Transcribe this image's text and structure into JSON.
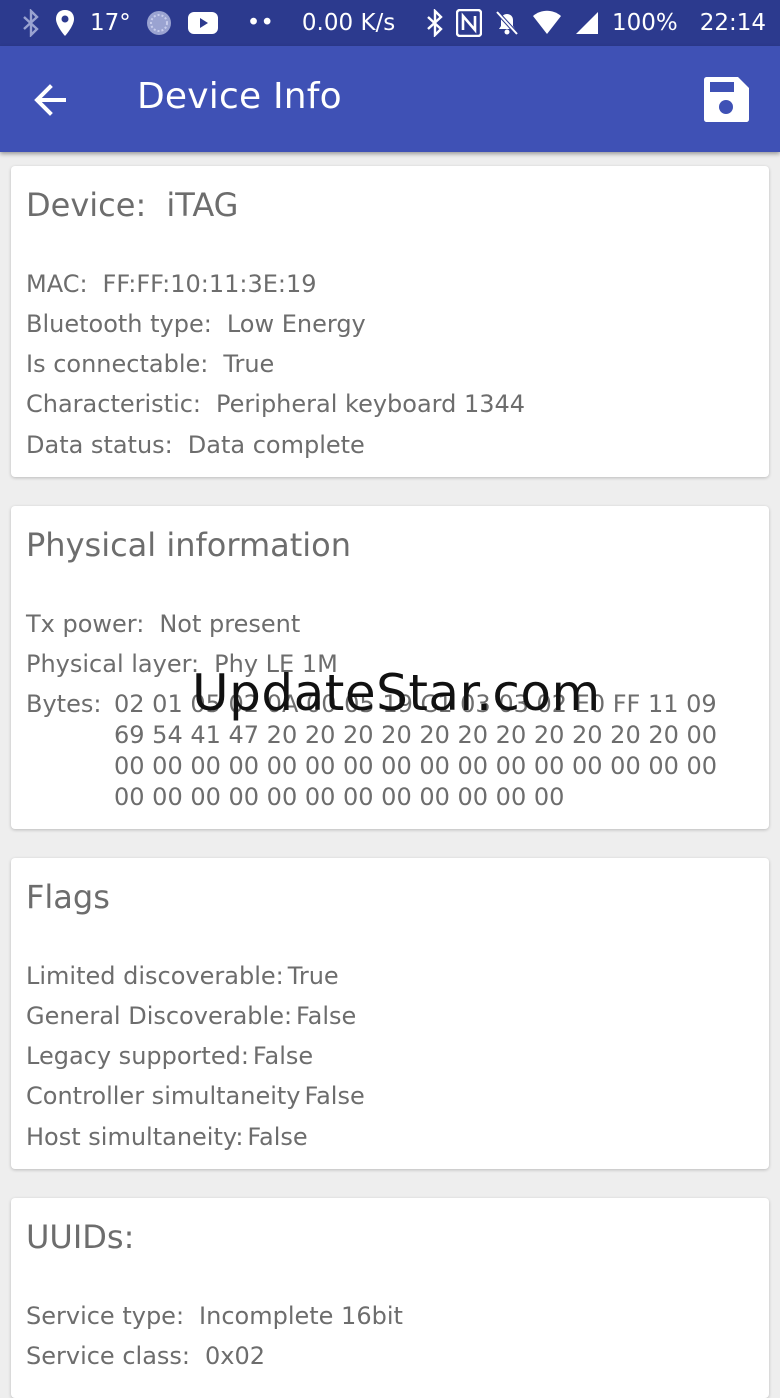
{
  "status_bar": {
    "temperature": "17°",
    "dots": "••",
    "speed": "0.00 K/s",
    "battery": "100%",
    "time": "22:14"
  },
  "app_bar": {
    "title": "Device Info",
    "back_icon": "arrow-back-icon",
    "save_icon": "save-icon"
  },
  "device_card": {
    "title_label": "Device:",
    "title_value": "iTAG",
    "rows": [
      {
        "label": "MAC:",
        "value": "FF:FF:10:11:3E:19"
      },
      {
        "label": "Bluetooth type:",
        "value": "Low Energy"
      },
      {
        "label": "Is connectable:",
        "value": "True"
      },
      {
        "label": "Characteristic:",
        "value": "Peripheral keyboard 1344"
      },
      {
        "label": "Data status:",
        "value": "Data complete"
      }
    ]
  },
  "physical_card": {
    "title": "Physical information",
    "rows": [
      {
        "label": "Tx power:",
        "value": "Not present"
      },
      {
        "label": "Physical layer:",
        "value": "Phy LE 1M"
      }
    ],
    "bytes_label": "Bytes:",
    "bytes_value": "02 01 05 02 0A 00 05 19 C1 03 03 02 E0 FF 11 09 69 54 41 47 20 20 20 20 20 20 20 20 20 20 20 00 00 00 00 00 00 00 00 00 00 00 00 00 00 00 00 00 00 00 00 00 00 00 00 00 00 00 00 00"
  },
  "flags_card": {
    "title": "Flags",
    "rows": [
      {
        "label": "Limited discoverable:",
        "value": "True"
      },
      {
        "label": "General Discoverable:",
        "value": "False"
      },
      {
        "label": "Legacy supported:",
        "value": "False"
      },
      {
        "label": "Controller simultaneity",
        "value": "False"
      },
      {
        "label": "Host simultaneity:",
        "value": "False"
      }
    ]
  },
  "uuids_card": {
    "title": "UUIDs:",
    "rows": [
      {
        "label": "Service type:",
        "value": "Incomplete 16bit"
      },
      {
        "label": "Service class:",
        "value": "0x02"
      }
    ]
  },
  "watermark": "UpdateStar.com",
  "colors": {
    "app_bar": "#3f51b5",
    "status_bar": "#2c3a8e",
    "text": "#6d6d6d",
    "background": "#eeeeee"
  }
}
